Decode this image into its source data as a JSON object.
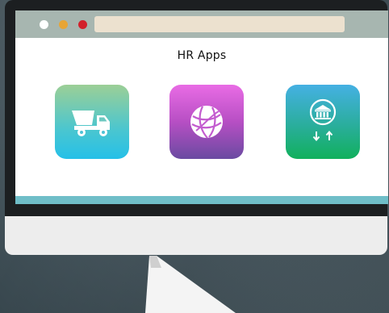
{
  "window": {
    "title": "HR Apps"
  },
  "apps": [
    {
      "icon": "dump-truck-icon"
    },
    {
      "icon": "globe-network-icon"
    },
    {
      "icon": "bank-transfer-icon"
    }
  ],
  "colors": {
    "monitor_bezel": "#1c1f21",
    "titlebar": "#a7b6b0",
    "address_bar": "#ece1cf",
    "dot_close": "#ffffff",
    "dot_minimize": "#e7a536",
    "dot_maximize": "#d2202b",
    "screen_bottom_bar": "#6fbec8"
  }
}
